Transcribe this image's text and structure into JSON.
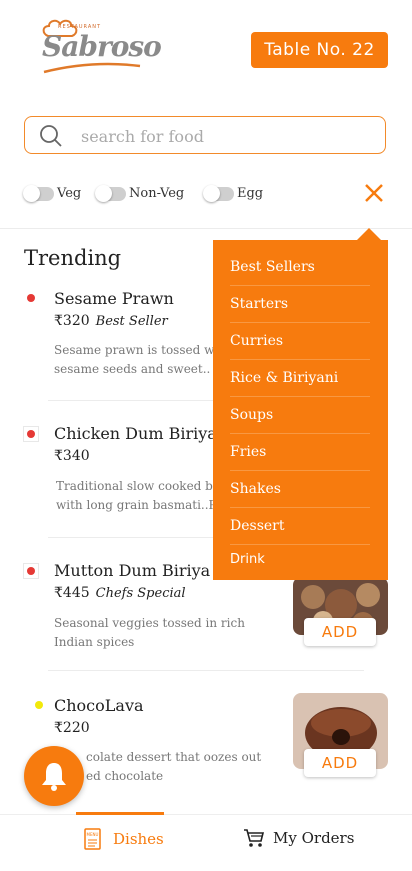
{
  "header": {
    "logo_small": "RESTAURANT",
    "logo_text": "Sabroso",
    "table_label": "Table No. 22"
  },
  "search": {
    "placeholder": "search for food"
  },
  "filters": [
    {
      "label": "Veg"
    },
    {
      "label": "Non-Veg"
    },
    {
      "label": "Egg"
    }
  ],
  "section": {
    "title": "Trending"
  },
  "items": [
    {
      "name": "Sesame Prawn",
      "price": "₹320",
      "tag": "Best Seller",
      "desc_line1": "Sesame prawn is tossed w",
      "desc_line2": "sesame seeds and sweet..",
      "dot_color": "#e53935"
    },
    {
      "name": "Chicken Dum Biriya",
      "price": "₹340",
      "tag": "",
      "desc_line1": "Traditional slow cooked b",
      "desc_line2": "with long grain basmati..R",
      "dot_color": "#e53935"
    },
    {
      "name": "Mutton Dum Biriya",
      "price": "₹445",
      "tag": "Chefs Special",
      "desc_line1": "Seasonal veggies tossed in rich",
      "desc_line2": "Indian spices",
      "dot_color": "#e53935",
      "add_label": "ADD"
    },
    {
      "name": "ChocoLava",
      "price": "₹220",
      "tag": "",
      "desc_line1": "colate dessert that oozes out",
      "desc_line2": "ed chocolate",
      "dot_color": "#f2e90b",
      "add_label": "ADD"
    }
  ],
  "menu": [
    "Best Sellers",
    "Starters",
    "Curries",
    "Rice & Biriyani",
    "Soups",
    "Fries",
    "Shakes",
    "Dessert",
    "Drink"
  ],
  "bottom_nav": {
    "dishes_label": "Dishes",
    "dishes_icon_text": "MENU",
    "orders_label": "My Orders"
  },
  "colors": {
    "accent": "#f77b0e",
    "veg_dot": "#f2e90b",
    "nonveg_dot": "#e53935"
  }
}
